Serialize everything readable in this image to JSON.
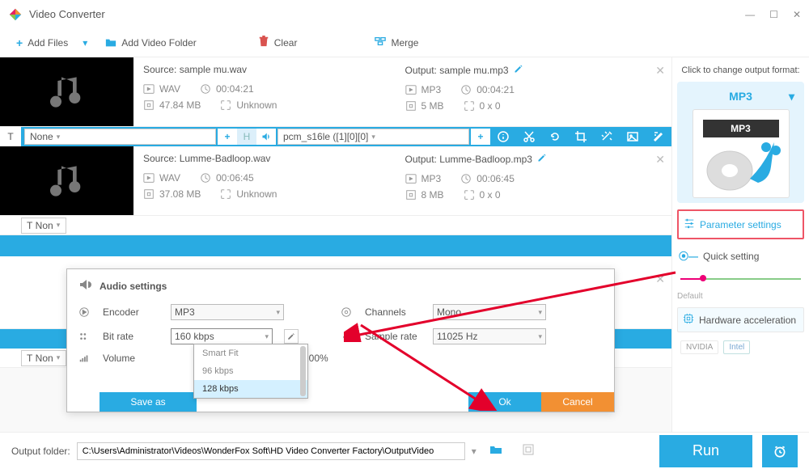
{
  "titlebar": {
    "title": "Video Converter"
  },
  "toolbar": {
    "add_files": "Add Files",
    "add_folder": "Add Video Folder",
    "clear": "Clear",
    "merge": "Merge"
  },
  "files": [
    {
      "source_label": "Source: sample mu.wav",
      "src_format": "WAV",
      "src_duration": "00:04:21",
      "src_size": "47.84 MB",
      "src_res": "Unknown",
      "output_label": "Output: sample mu.mp3",
      "out_format": "MP3",
      "out_duration": "00:04:21",
      "out_size": "5 MB",
      "out_res": "0 x 0",
      "subtitle_sel": "None",
      "audio_sel": "pcm_s16le ([1][0][0]"
    },
    {
      "source_label": "Source: Lumme-Badloop.wav",
      "src_format": "WAV",
      "src_duration": "00:06:45",
      "src_size": "37.08 MB",
      "src_res": "Unknown",
      "output_label": "Output: Lumme-Badloop.mp3",
      "out_format": "MP3",
      "out_duration": "00:06:45",
      "out_size": "8 MB",
      "out_res": "0 x 0",
      "subtitle_sel": "Non"
    }
  ],
  "extra_rows": {
    "stub_sel": "Non"
  },
  "right": {
    "click_label": "Click to change output format:",
    "format": "MP3",
    "format_badge": "MP3",
    "param_settings": "Parameter settings",
    "quick": "Quick setting",
    "default": "Default",
    "hw_accel": "Hardware acceleration",
    "nvidia": "NVIDIA",
    "intel": "Intel"
  },
  "modal": {
    "title": "Audio settings",
    "encoder_label": "Encoder",
    "encoder_value": "MP3",
    "bitrate_label": "Bit rate",
    "bitrate_value": "160 kbps",
    "volume_label": "Volume",
    "volume_pct": "100%",
    "channels_label": "Channels",
    "channels_value": "Mono",
    "sample_label": "Sample rate",
    "sample_value": "11025 Hz",
    "save": "Save as",
    "ok": "Ok",
    "cancel": "Cancel",
    "options": [
      "Smart Fit",
      "96 kbps",
      "128 kbps"
    ]
  },
  "footer": {
    "label": "Output folder:",
    "path": "C:\\Users\\Administrator\\Videos\\WonderFox Soft\\HD Video Converter Factory\\OutputVideo",
    "run": "Run"
  }
}
